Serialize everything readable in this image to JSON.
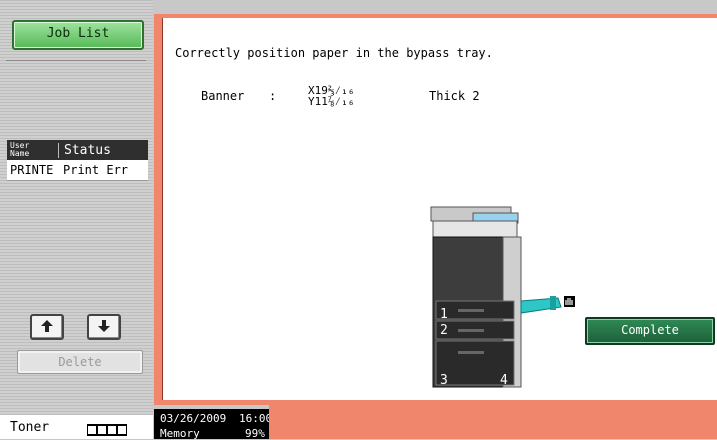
{
  "sidebar": {
    "job_list_button": "Job List",
    "table": {
      "col_user": "User\nName",
      "col_status": "Status",
      "rows": [
        {
          "user": "PRINTE",
          "status": "Print Err"
        }
      ]
    },
    "up_icon": "arrow-up-icon",
    "down_icon": "arrow-down-icon",
    "delete_button": "Delete",
    "toner_label": "Toner",
    "toner_level": 1.0
  },
  "main": {
    "message": "Correctly position paper in the bypass tray.",
    "paper_label": "Banner",
    "paper_colon": ":",
    "paper_x": "X19⅔⁄₁₆",
    "paper_y": "Y11⅞⁄₁₆",
    "paper_type": "Thick 2",
    "tray_numbers": [
      "1",
      "2",
      "3",
      "4"
    ],
    "complete_button": "Complete"
  },
  "status": {
    "date": "03/26/2009",
    "time": "16:00",
    "memory_label": "Memory",
    "memory_value": "99%"
  },
  "colors": {
    "accent_frame": "#f0866b",
    "joblist_green": "#6cc96c",
    "complete_green": "#267a48"
  }
}
